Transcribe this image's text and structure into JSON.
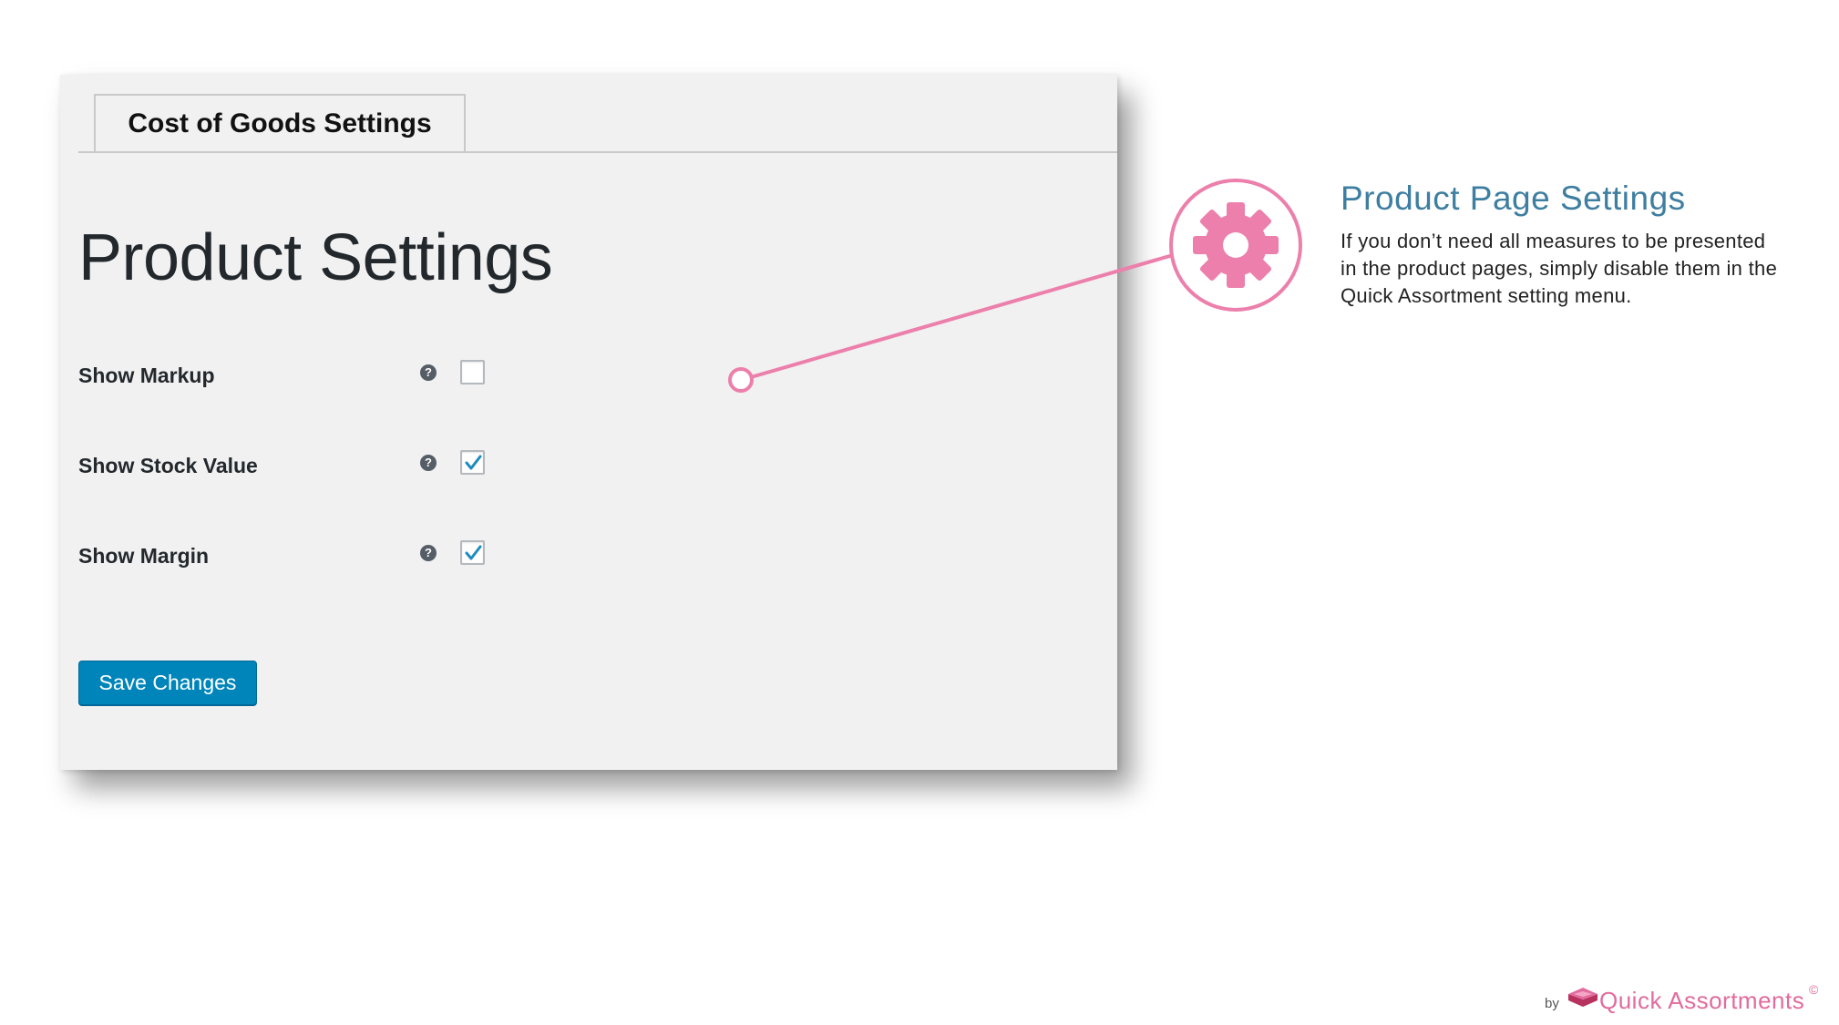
{
  "tab": {
    "label": "Cost of Goods Settings"
  },
  "page_title": "Product Settings",
  "settings": [
    {
      "label": "Show Markup",
      "help": "?",
      "checked": false
    },
    {
      "label": "Show Stock Value",
      "help": "?",
      "checked": true
    },
    {
      "label": "Show Margin",
      "help": "?",
      "checked": true
    }
  ],
  "save_button": {
    "label": "Save Changes"
  },
  "callout": {
    "title": "Product Page Settings",
    "text": "If you don’t need all measures to be presented in the product pages, simply disable them in the Quick Assortment setting menu.",
    "icon": "gear-icon",
    "accent_color": "#ec7fab"
  },
  "branding": {
    "by": "by",
    "name": "Quick Assortments",
    "copyright": "©",
    "logo_icon": "stacked-box-logo"
  },
  "colors": {
    "primary_button": "#0085ba",
    "checkmark": "#1e8cbe",
    "title_blue": "#3e7ea1",
    "brand_pink": "#e26b9e"
  }
}
